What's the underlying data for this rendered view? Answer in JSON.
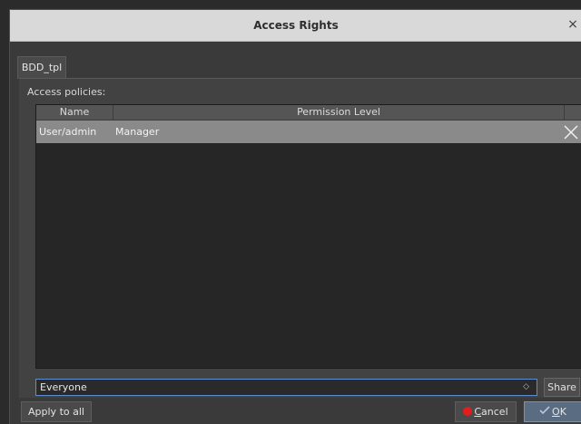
{
  "window": {
    "title": "Access Rights",
    "close_symbol": "×"
  },
  "tabs": [
    {
      "label": "BDD_tpl"
    }
  ],
  "section_label": "Access policies:",
  "table": {
    "columns": [
      "Name",
      "Permission Level"
    ],
    "rows": [
      {
        "name": "User/admin",
        "permission": "Manager"
      }
    ]
  },
  "principal_select": {
    "value": "Everyone",
    "arrow": "◇"
  },
  "share_label": "Share",
  "apply_all_label": "Apply to all",
  "cancel": {
    "mnemonic": "C",
    "rest": "ancel"
  },
  "ok": {
    "mnemonic": "O",
    "rest": "K"
  },
  "colors": {
    "accent": "#5d8fd0",
    "cancel_icon": "#e31c1c",
    "selected_row": "#8a8a8a"
  },
  "icons": [
    "close-icon",
    "remove-row-icon",
    "dropdown-arrow-icon",
    "cancel-icon",
    "ok-check-icon"
  ]
}
